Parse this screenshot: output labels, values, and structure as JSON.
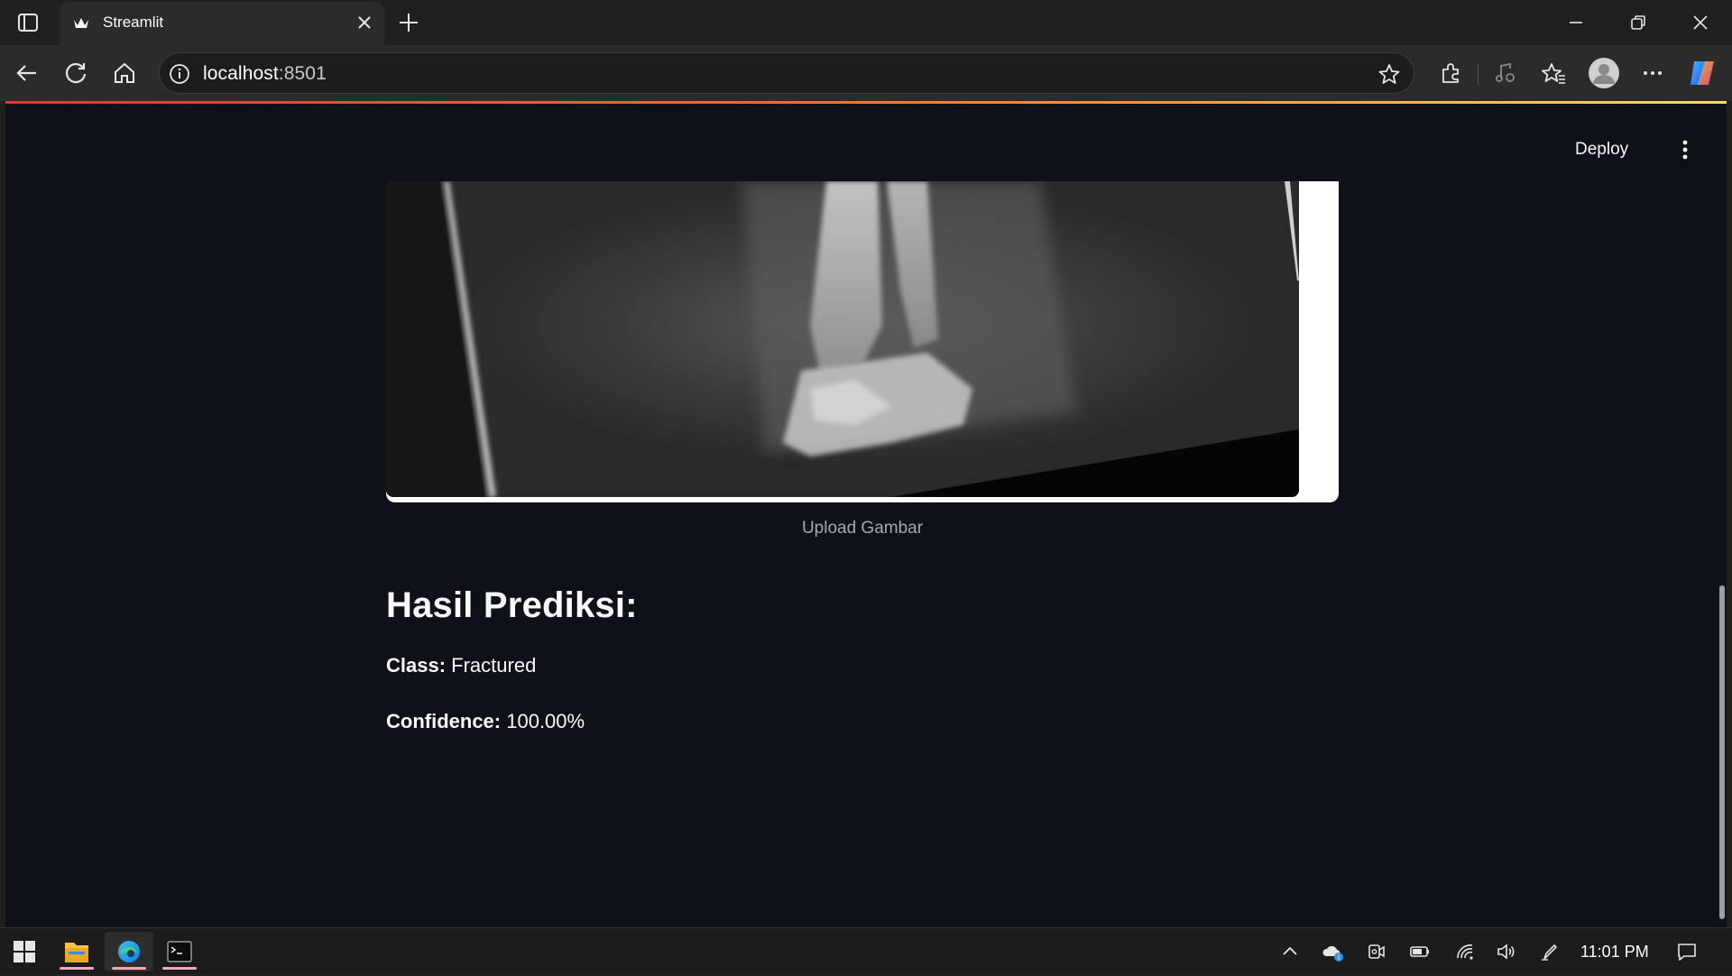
{
  "browser": {
    "tab_title": "Streamlit",
    "address_host": "localhost",
    "address_port": ":8501"
  },
  "app": {
    "deploy_label": "Deploy",
    "image_caption": "Upload Gambar",
    "result_heading": "Hasil Prediksi:",
    "class_label": "Class:",
    "class_value": " Fractured",
    "confidence_label": "Confidence:",
    "confidence_value": " 100.00%"
  },
  "taskbar": {
    "clock": "11:01 PM"
  },
  "colors": {
    "page_bg": "#0e1117",
    "text": "#fafafa",
    "caption": "#a3a8b8",
    "loading_gradient_start": "#e83434",
    "loading_gradient_end": "#f7dc5c"
  },
  "icons": [
    "tab-actions-icon",
    "streamlit-crown-icon",
    "close-icon",
    "plus-icon",
    "minimize-icon",
    "restore-icon",
    "back-icon",
    "refresh-icon",
    "home-icon",
    "info-icon",
    "star-icon",
    "extensions-icon",
    "media-icon",
    "favorites-icon",
    "profile-icon",
    "more-icon",
    "copilot-icon",
    "kebab-icon",
    "windows-start-icon",
    "file-explorer-icon",
    "edge-icon",
    "terminal-icon",
    "chevron-up-icon",
    "onedrive-icon",
    "camera-icon",
    "battery-icon",
    "wifi-icon",
    "volume-icon",
    "pen-icon",
    "notification-icon"
  ]
}
